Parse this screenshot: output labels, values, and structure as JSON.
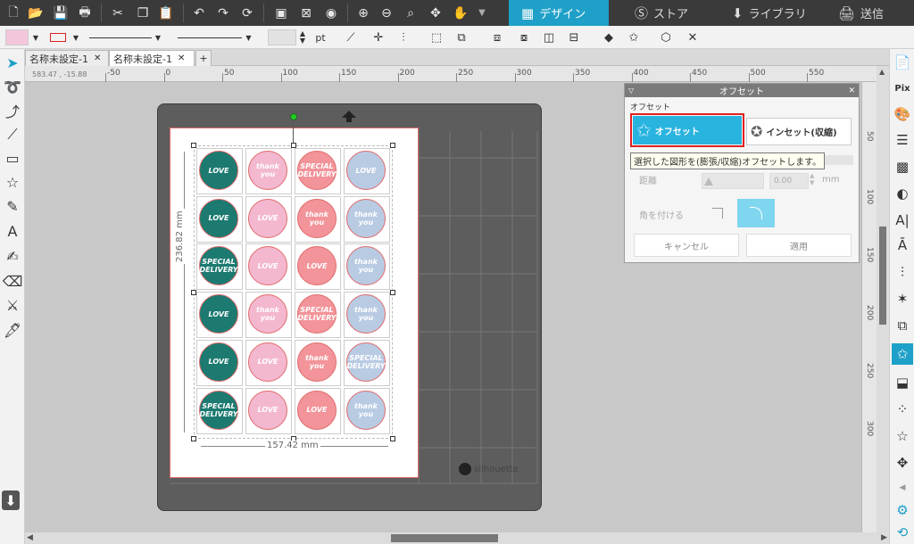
{
  "toolbar": {
    "icons": [
      "new-file-icon",
      "open-folder-icon",
      "save-icon",
      "print-icon",
      "cut-icon",
      "copy-icon",
      "paste-icon",
      "undo-icon",
      "redo-icon",
      "refresh-icon",
      "group-icon",
      "ungroup-icon",
      "select-all-icon",
      "zoom-in-icon",
      "zoom-out-icon",
      "zoom-fit-icon",
      "move-icon",
      "pan-hand-icon"
    ],
    "tabs": [
      {
        "label": "デザイン",
        "icon": "grid-icon",
        "active": true
      },
      {
        "label": "ストア",
        "icon": "store-icon",
        "active": false
      },
      {
        "label": "ライブラリ",
        "icon": "library-icon",
        "active": false
      },
      {
        "label": "送信",
        "icon": "send-icon",
        "active": false
      }
    ]
  },
  "options": {
    "unit": "pt"
  },
  "document_tabs": [
    {
      "label": "名称未設定-1"
    },
    {
      "label": "名称未設定-1"
    }
  ],
  "add_tab": "+",
  "coordinates": "583.47 , -15.88",
  "ruler": {
    "top": [
      "-50",
      "0",
      "50",
      "100",
      "150",
      "200",
      "250",
      "300",
      "350",
      "400",
      "450",
      "500",
      "550"
    ],
    "side": [
      "50",
      "100",
      "150",
      "200",
      "250",
      "300"
    ]
  },
  "design": {
    "width_label": "157.42 mm",
    "height_label": "236.82 mm",
    "brand": "silhouette",
    "stickers": [
      [
        "love",
        "thank",
        "special",
        "love"
      ],
      [
        "love",
        "love",
        "thank",
        "thank"
      ],
      [
        "special",
        "love",
        "love",
        "thank"
      ],
      [
        "love",
        "thank",
        "special",
        "thank"
      ],
      [
        "love",
        "love",
        "thank",
        "special"
      ],
      [
        "special",
        "love",
        "love",
        "thank"
      ]
    ],
    "sticker_text": {
      "love": "LOVE",
      "thank": "thank you",
      "special": "SPECIAL DELIVERY"
    }
  },
  "panel": {
    "title": "オフセット",
    "section": "オフセット",
    "offset_button": "オフセット",
    "inset_button": "インセット(収縮)",
    "tooltip": "選択した図形を(膨張/収縮)オフセットします。",
    "distance_label": "距離",
    "distance_value": "0.00",
    "distance_unit": "mm",
    "corner_label": "角を付ける",
    "cancel": "キャンセル",
    "apply": "適用"
  },
  "colors": {
    "accent": "#1fa0c8",
    "teal": "#1c7a70",
    "pink": "#f3b8cf",
    "coral": "#f2949a",
    "blue": "#b9cbe3",
    "highlight": "#e02020"
  }
}
